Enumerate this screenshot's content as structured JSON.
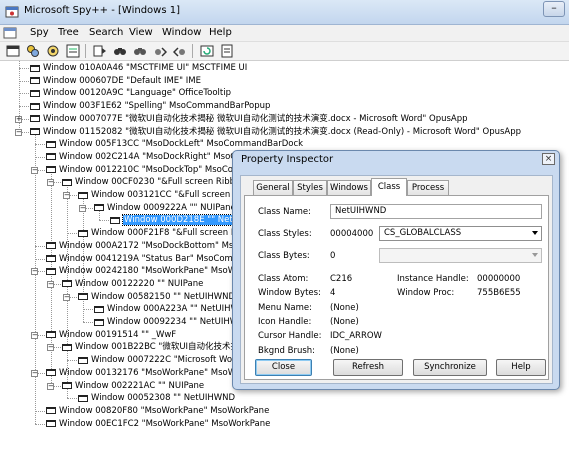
{
  "window": {
    "title": "Microsoft Spy++ - [Windows 1]",
    "minimize_glyph": "–"
  },
  "menu": {
    "items": [
      "Spy",
      "Tree",
      "Search",
      "View",
      "Window",
      "Help"
    ]
  },
  "tree": {
    "rows": [
      {
        "label": "Window 010A0A46 \"MSCTFIME UI\" MSCTFIME UI",
        "depth": 1,
        "expander": ""
      },
      {
        "label": "Window 000607DE \"Default IME\" IME",
        "depth": 1,
        "expander": ""
      },
      {
        "label": "Window 00120A9C \"Language\" OfficeTooltip",
        "depth": 1,
        "expander": ""
      },
      {
        "label": "Window 003F1E62 \"Spelling\" MsoCommandBarPopup",
        "depth": 1,
        "expander": ""
      },
      {
        "label": "Window 0007077E \"微软UI自动化技术揭秘 微软UI自动化测试的技术演变.docx - Microsoft Word\" OpusApp",
        "depth": 1,
        "expander": "+"
      },
      {
        "label": "Window 01152082 \"微软UI自动化技术揭秘 微软UI自动化测试的技术演变.docx (Read-Only) - Microsoft Word\" OpusApp",
        "depth": 1,
        "expander": "−"
      },
      {
        "label": "Window 005F13CC \"MsoDockLeft\" MsoCommandBarDock",
        "depth": 2,
        "expander": ""
      },
      {
        "label": "Window 002C214A \"MsoDockRight\" MsoCommandBarDock",
        "depth": 2,
        "expander": ""
      },
      {
        "label": "Window 0012210C \"MsoDockTop\" MsoCommandBarDock",
        "depth": 2,
        "expander": "−"
      },
      {
        "label": "Window 00CF0230 \"&Full screen Ribbon\" MsoCommandBar",
        "depth": 3,
        "expander": "−"
      },
      {
        "label": "Window 003121CC \"&Full screen Ribbon\" MsoWorkPane",
        "depth": 4,
        "expander": "−"
      },
      {
        "label": "Window 0009222A \"\" NUIPane",
        "depth": 5,
        "expander": "−"
      },
      {
        "label": "Window 000D218E \"\" NetUIHWND",
        "depth": 6,
        "expander": "",
        "selected": true
      },
      {
        "label": "Window 000F21F8 \"&Full screen Ribbon\" MsoWorkPane",
        "depth": 4,
        "expander": ""
      },
      {
        "label": "Window 000A2172 \"MsoDockBottom\" MsoCommandBarDock",
        "depth": 2,
        "expander": ""
      },
      {
        "label": "Window 0041219A \"Status Bar\" MsoCommandBar",
        "depth": 2,
        "expander": ""
      },
      {
        "label": "Window 00242180 \"MsoWorkPane\" MsoWorkPane",
        "depth": 2,
        "expander": "−"
      },
      {
        "label": "Window 00122220 \"\" NUIPane",
        "depth": 3,
        "expander": "−"
      },
      {
        "label": "Window 00582150 \"\" NetUIHWND",
        "depth": 4,
        "expander": "−"
      },
      {
        "label": "Window 000A223A \"\" NetUIHWND",
        "depth": 5,
        "expander": ""
      },
      {
        "label": "Window 00092234 \"\" NetUIHWND",
        "depth": 5,
        "expander": ""
      },
      {
        "label": "Window 00191514 \"\" _WwF",
        "depth": 2,
        "expander": "−"
      },
      {
        "label": "Window 001B22BC \"微软UI自动化技术揭秘\" _WwB",
        "depth": 3,
        "expander": "−"
      },
      {
        "label": "Window 0007222C \"Microsoft Word Document\" _WwG",
        "depth": 4,
        "expander": ""
      },
      {
        "label": "Window 00132176 \"MsoWorkPane\" MsoWorkPane",
        "depth": 2,
        "expander": "−"
      },
      {
        "label": "Window 002221AC \"\" NUIPane",
        "depth": 3,
        "expander": "−"
      },
      {
        "label": "Window 00052308 \"\" NetUIHWND",
        "depth": 4,
        "expander": ""
      },
      {
        "label": "Window 00820F80 \"MsoWorkPane\" MsoWorkPane",
        "depth": 2,
        "expander": ""
      },
      {
        "label": "Window 00EC1FC2 \"MsoWorkPane\" MsoWorkPane",
        "depth": 2,
        "expander": ""
      }
    ]
  },
  "dialog": {
    "title": "Property Inspector",
    "close_glyph": "×",
    "tabs": [
      "General",
      "Styles",
      "Windows",
      "Class",
      "Process"
    ],
    "active_tab": "Class",
    "class_name_label": "Class Name:",
    "class_name_value": "NetUIHWND",
    "class_styles_label": "Class Styles:",
    "class_styles_value": "00004000",
    "class_styles_combo": "CS_GLOBALCLASS",
    "class_bytes_label": "Class Bytes:",
    "class_bytes_value": "0",
    "class_atom_label": "Class Atom:",
    "class_atom_value": "C216",
    "window_bytes_label": "Window Bytes:",
    "window_bytes_value": "4",
    "menu_name_label": "Menu Name:",
    "menu_name_value": "(None)",
    "icon_handle_label": "Icon Handle:",
    "icon_handle_value": "(None)",
    "cursor_handle_label": "Cursor Handle:",
    "cursor_handle_value": "IDC_ARROW",
    "bkgnd_brush_label": "Bkgnd Brush:",
    "bkgnd_brush_value": "(None)",
    "instance_handle_label": "Instance Handle:",
    "instance_handle_value": "00000000",
    "window_proc_label": "Window Proc:",
    "window_proc_value": "755B6E55",
    "buttons": {
      "close": "Close",
      "refresh": "Refresh",
      "synchronize": "Synchronize",
      "help": "Help"
    }
  },
  "colors": {
    "selection": "#3399ff",
    "dialog_frame": "#c9daf0"
  }
}
